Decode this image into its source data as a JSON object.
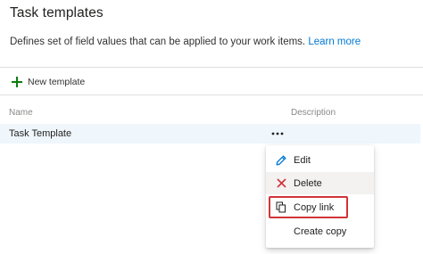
{
  "page": {
    "title": "Task templates",
    "subtitle": "Defines set of field values that can be applied to your work items.",
    "learn_more": "Learn more"
  },
  "toolbar": {
    "new_template_label": "New template"
  },
  "table": {
    "columns": [
      "Name",
      "Description"
    ],
    "rows": [
      {
        "name": "Task Template",
        "description": ""
      }
    ]
  },
  "context_menu": {
    "items": [
      {
        "label": "Edit",
        "icon": "pencil-icon"
      },
      {
        "label": "Delete",
        "icon": "x-icon"
      },
      {
        "label": "Copy link",
        "icon": "copy-icon",
        "highlighted": true
      },
      {
        "label": "Create copy",
        "icon": ""
      }
    ]
  },
  "colors": {
    "accent": "#0078d4",
    "add_green": "#107c10",
    "delete_red": "#d13438",
    "row_selected": "#eff6fc",
    "highlight_border": "#d13438"
  }
}
